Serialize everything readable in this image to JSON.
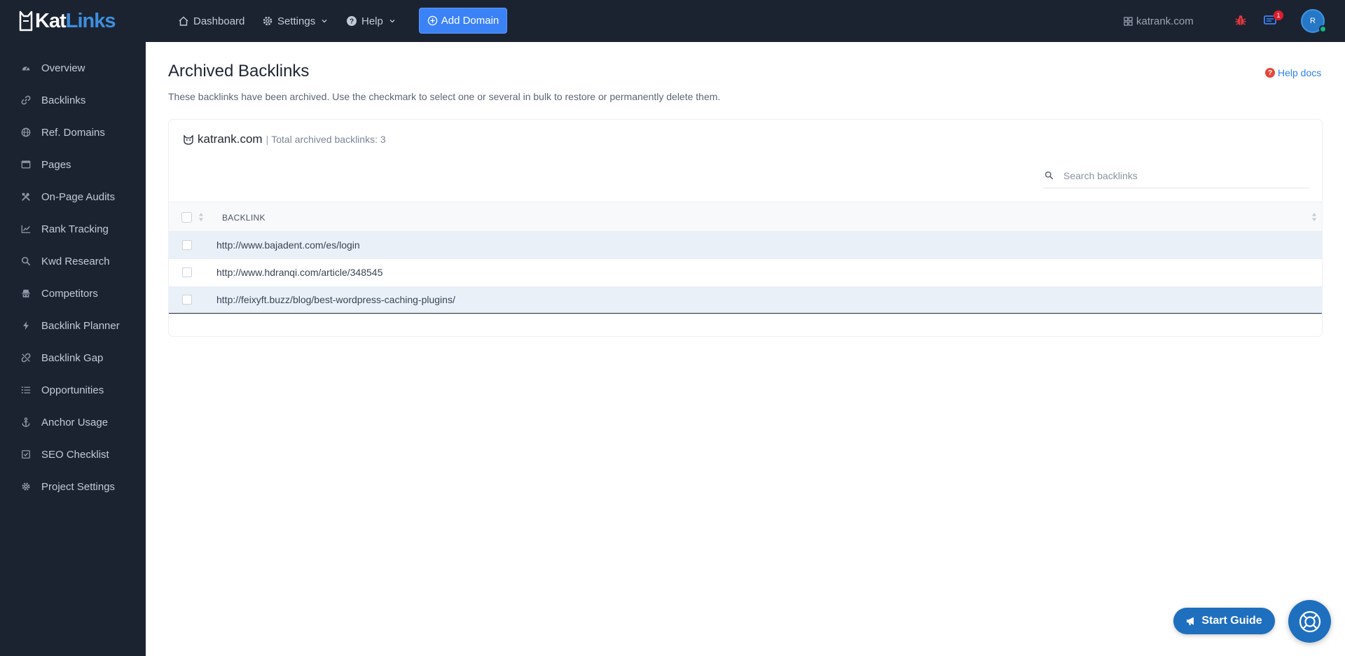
{
  "brand": {
    "kat": "Kat",
    "links": "Links"
  },
  "sidebar": {
    "items": [
      {
        "label": "Overview",
        "icon": "gauge-icon"
      },
      {
        "label": "Backlinks",
        "icon": "link-icon"
      },
      {
        "label": "Ref. Domains",
        "icon": "globe-icon"
      },
      {
        "label": "Pages",
        "icon": "window-icon"
      },
      {
        "label": "On-Page Audits",
        "icon": "tools-icon"
      },
      {
        "label": "Rank Tracking",
        "icon": "chart-line-icon"
      },
      {
        "label": "Kwd Research",
        "icon": "search-icon"
      },
      {
        "label": "Competitors",
        "icon": "spy-icon"
      },
      {
        "label": "Backlink Planner",
        "icon": "bolt-icon"
      },
      {
        "label": "Backlink Gap",
        "icon": "unlink-icon"
      },
      {
        "label": "Opportunities",
        "icon": "list-icon"
      },
      {
        "label": "Anchor Usage",
        "icon": "anchor-icon"
      },
      {
        "label": "SEO Checklist",
        "icon": "check-square-icon"
      },
      {
        "label": "Project Settings",
        "icon": "gear-icon"
      }
    ]
  },
  "topbar": {
    "dashboard": "Dashboard",
    "settings": "Settings",
    "help": "Help",
    "add_domain": "Add Domain",
    "domain": "katrank.com",
    "notification_count": "1",
    "avatar_initial": "R"
  },
  "page": {
    "title": "Archived Backlinks",
    "help_docs": "Help docs",
    "description": "These backlinks have been archived. Use the checkmark to select one or several in bulk to restore or permanently delete them."
  },
  "card": {
    "domain": "katrank.com",
    "separator": "|",
    "total_label": "Total archived backlinks: 3",
    "search_placeholder": "Search backlinks"
  },
  "table": {
    "column_header": "BACKLINK",
    "rows": [
      "http://www.bajadent.com/es/login",
      "http://www.hdranqi.com/article/348545",
      "http://feixyft.buzz/blog/best-wordpress-caching-plugins/"
    ]
  },
  "floating": {
    "start_guide": "Start Guide"
  },
  "colors": {
    "sidebar_bg": "#1c2330",
    "accent": "#3b82f6",
    "brand_blue": "#3d8fe0",
    "row_highlight": "#e9f0f8"
  }
}
